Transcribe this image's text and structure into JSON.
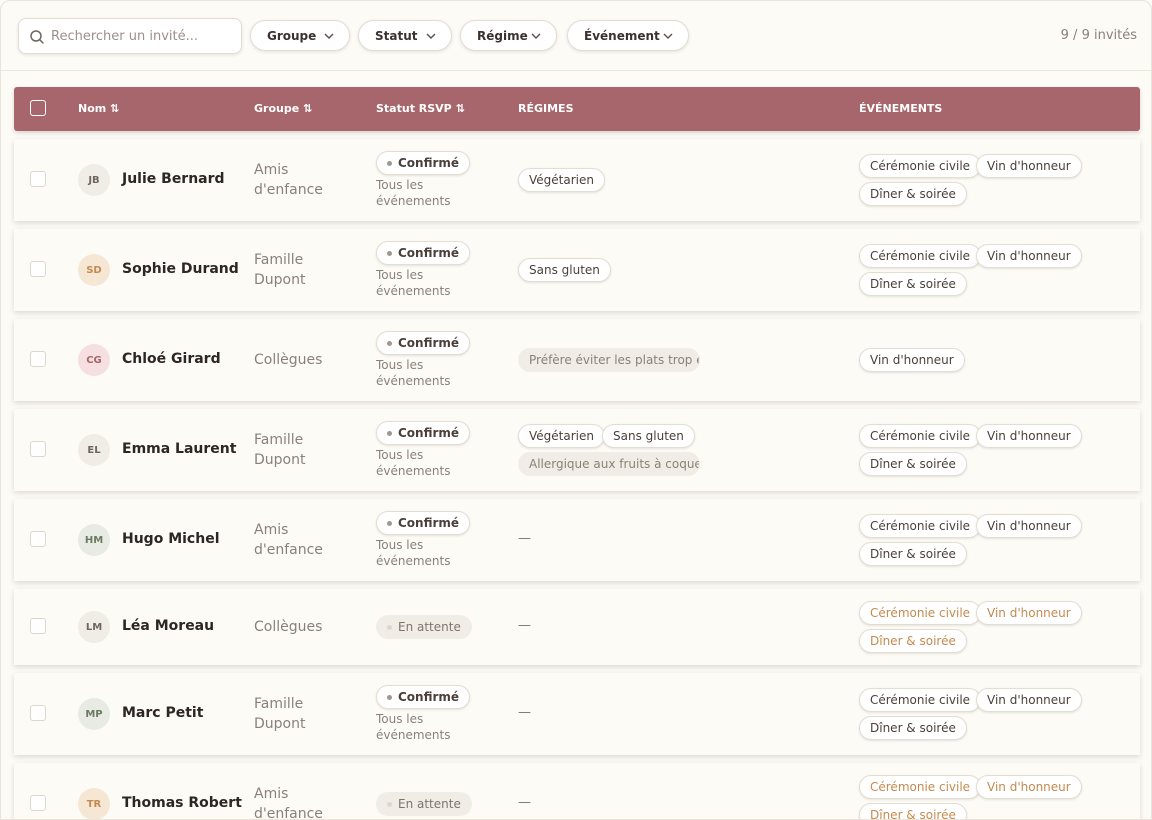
{
  "search": {
    "placeholder": "Rechercher un invité..."
  },
  "filters": {
    "group": "Groupe",
    "status": "Statut",
    "diet": "Régime",
    "event": "Événement"
  },
  "counter": "9 / 9 invités",
  "columns": {
    "name": "Nom ⇅",
    "group": "Groupe ⇅",
    "status": "Statut RSVP ⇅",
    "diets": "RÉGIMES",
    "events": "ÉVÉNEMENTS"
  },
  "colors": {
    "header": "#a7666b",
    "pending_event": "#c48a4f"
  },
  "events_all": [
    "Cérémonie civile",
    "Vin d'honneur",
    "Dîner & soirée"
  ],
  "guests": [
    {
      "initials": "JB",
      "name": "Julie Bernard",
      "group_l1": "Amis",
      "group_l2": "d'enfance",
      "status": "Confirmé",
      "status_sub_l1": "Tous les",
      "status_sub_l2": "événements",
      "diets": [
        "Végétarien"
      ],
      "events": [
        "Cérémonie civile",
        "Vin d'honneur",
        "Dîner & soirée"
      ]
    },
    {
      "initials": "SD",
      "name": "Sophie Durand",
      "group_l1": "Famille",
      "group_l2": "Dupont",
      "status": "Confirmé",
      "status_sub_l1": "Tous les",
      "status_sub_l2": "événements",
      "diets": [
        "Sans gluten"
      ],
      "events": [
        "Cérémonie civile",
        "Vin d'honneur",
        "Dîner & soirée"
      ]
    },
    {
      "initials": "CG",
      "name": "Chloé Girard",
      "group_l1": "Collègues",
      "group_l2": "",
      "status": "Confirmé",
      "status_sub_l1": "Tous les",
      "status_sub_l2": "événements",
      "diet_note": "Préfère éviter les plats trop épi",
      "events": [
        "Vin d'honneur"
      ]
    },
    {
      "initials": "EL",
      "name": "Emma Laurent",
      "group_l1": "Famille",
      "group_l2": "Dupont",
      "status": "Confirmé",
      "status_sub_l1": "Tous les",
      "status_sub_l2": "événements",
      "diets": [
        "Végétarien",
        "Sans gluten"
      ],
      "diet_note": "Allergique aux fruits à coque (é",
      "events": [
        "Cérémonie civile",
        "Vin d'honneur",
        "Dîner & soirée"
      ]
    },
    {
      "initials": "HM",
      "name": "Hugo Michel",
      "group_l1": "Amis",
      "group_l2": "d'enfance",
      "status": "Confirmé",
      "status_sub_l1": "Tous les",
      "status_sub_l2": "événements",
      "no_diet": "—",
      "events": [
        "Cérémonie civile",
        "Vin d'honneur",
        "Dîner & soirée"
      ]
    },
    {
      "initials": "LM",
      "name": "Léa Moreau",
      "group_l1": "Collègues",
      "group_l2": "",
      "status": "En attente",
      "no_diet": "—",
      "events": [
        "Cérémonie civile",
        "Vin d'honneur",
        "Dîner & soirée"
      ]
    },
    {
      "initials": "MP",
      "name": "Marc Petit",
      "group_l1": "Famille",
      "group_l2": "Dupont",
      "status": "Confirmé",
      "status_sub_l1": "Tous les",
      "status_sub_l2": "événements",
      "no_diet": "—",
      "events": [
        "Cérémonie civile",
        "Vin d'honneur",
        "Dîner & soirée"
      ]
    },
    {
      "initials": "TR",
      "name": "Thomas Robert",
      "group_l1": "Amis",
      "group_l2": "d'enfance",
      "status": "En attente",
      "no_diet": "—",
      "events": [
        "Cérémonie civile",
        "Vin d'honneur",
        "Dîner & soirée"
      ]
    }
  ]
}
